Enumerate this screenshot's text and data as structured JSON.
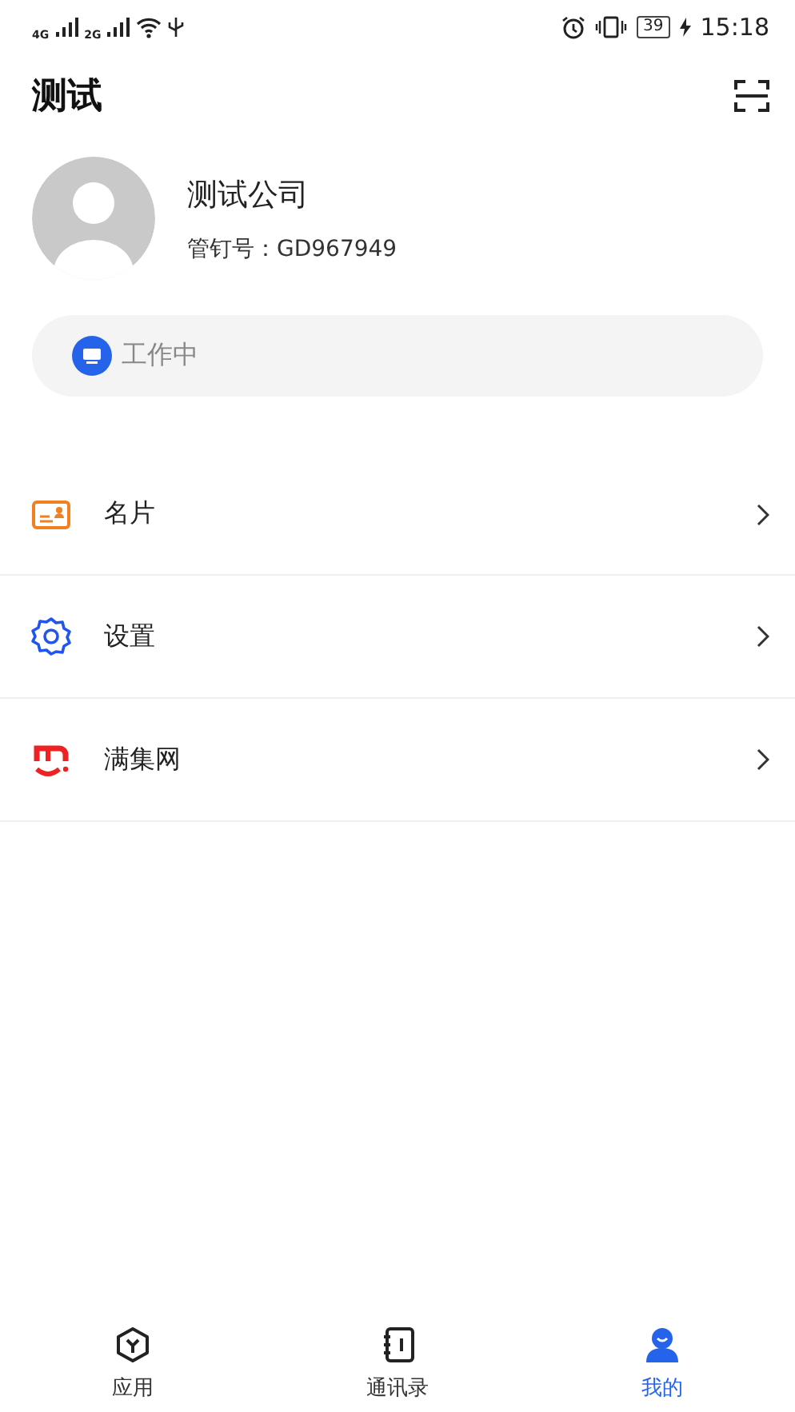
{
  "status_bar": {
    "network_1": "4G",
    "network_2": "2G",
    "battery": "39",
    "time": "15:18"
  },
  "header": {
    "title": "测试"
  },
  "profile": {
    "name": "测试公司",
    "id_label": "管钉号：GD967949"
  },
  "work_status": {
    "label": "工作中"
  },
  "menu": [
    {
      "label": "名片"
    },
    {
      "label": "设置"
    },
    {
      "label": "满集网"
    }
  ],
  "tabs": [
    {
      "label": "应用",
      "selected": false
    },
    {
      "label": "通讯录",
      "selected": false
    },
    {
      "label": "我的",
      "selected": true
    }
  ]
}
